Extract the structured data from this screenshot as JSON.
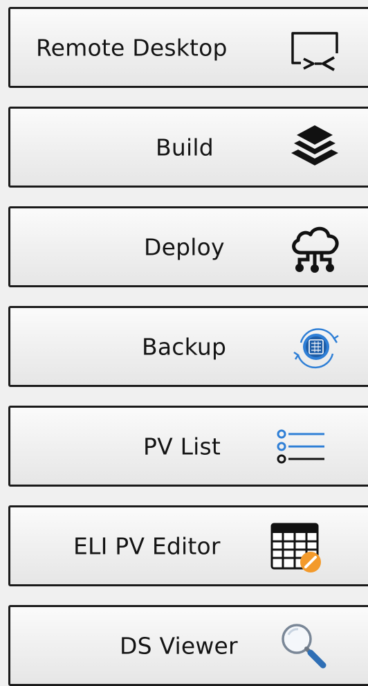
{
  "launcher": {
    "buttons": [
      {
        "label": "Remote Desktop",
        "icon": "remote-desktop-icon"
      },
      {
        "label": "Build",
        "icon": "layers-icon"
      },
      {
        "label": "Deploy",
        "icon": "cloud-network-icon"
      },
      {
        "label": "Backup",
        "icon": "backup-sync-icon"
      },
      {
        "label": "PV List",
        "icon": "list-icon"
      },
      {
        "label": "ELI PV Editor",
        "icon": "table-edit-icon"
      },
      {
        "label": "DS Viewer",
        "icon": "magnifier-icon"
      }
    ]
  },
  "colors": {
    "background": "#f0f0f0",
    "border": "#1a1a1a",
    "text": "#141414",
    "accent_blue": "#2f7fd6",
    "accent_orange": "#f39a2b"
  }
}
